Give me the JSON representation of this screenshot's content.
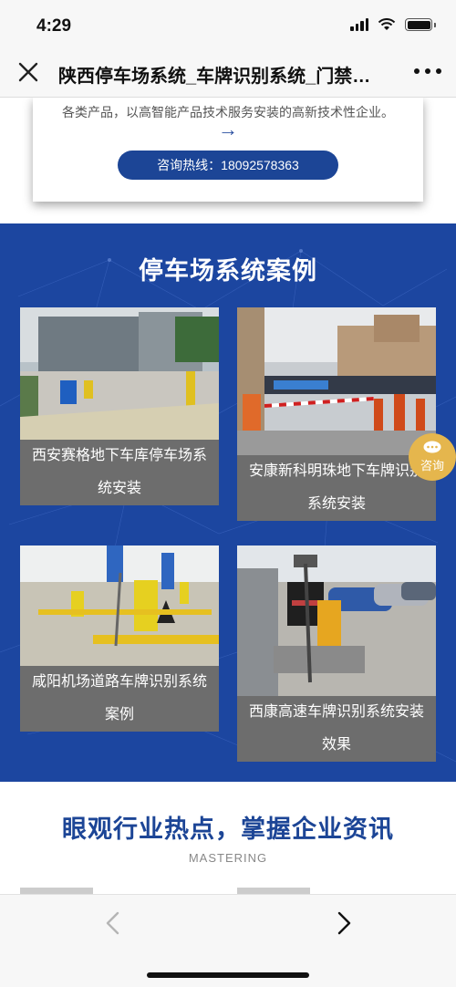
{
  "status_bar": {
    "time": "4:29"
  },
  "nav": {
    "title": "陕西停车场系统_车牌识别系统_门禁…"
  },
  "intro": {
    "text": "各类产品，以高智能产品技术服务安装的高新技术性企业。",
    "arrow": "→",
    "hotline_label": "咨询热线：18092578363"
  },
  "cases": {
    "title": "停车场系统案例",
    "items": [
      {
        "caption": "西安赛格地下车库停车场系统安装"
      },
      {
        "caption": "安康新科明珠地下车牌识别系统安装"
      },
      {
        "caption": "咸阳机场道路车牌识别系统案例"
      },
      {
        "caption": "西康高速车牌识别系统安装效果"
      }
    ]
  },
  "float_consult": {
    "label": "咨询"
  },
  "news": {
    "title": "眼观行业热点，掌握企业资讯",
    "subtitle": "MASTERING"
  },
  "colors": {
    "brand_blue": "#1c46a0",
    "caption_gray": "#6d6d6d",
    "consult_gold": "#e5b64d"
  }
}
